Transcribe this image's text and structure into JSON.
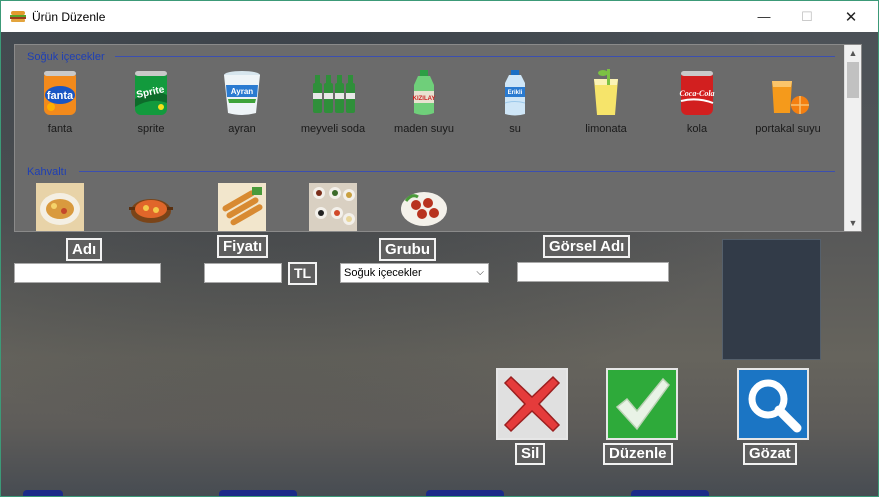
{
  "window": {
    "title": "Ürün Düzenle",
    "controls": {
      "minimize": "—",
      "maximize": "☐",
      "close": "✕"
    }
  },
  "groups": [
    {
      "name": "Soğuk içecekler",
      "items": [
        {
          "label": "fanta",
          "icon": "fanta-can-icon"
        },
        {
          "label": "sprite",
          "icon": "sprite-can-icon"
        },
        {
          "label": "ayran",
          "icon": "ayran-cup-icon"
        },
        {
          "label": "meyveli soda",
          "icon": "fruit-soda-bottles-icon"
        },
        {
          "label": "maden suyu",
          "icon": "mineral-water-bottle-icon"
        },
        {
          "label": "su",
          "icon": "water-bottle-icon"
        },
        {
          "label": "limonata",
          "icon": "lemonade-glass-icon"
        },
        {
          "label": "kola",
          "icon": "cola-can-icon"
        },
        {
          "label": "portakal suyu",
          "icon": "orange-juice-icon"
        }
      ]
    },
    {
      "name": "Kahvaltı",
      "items": [
        {
          "label": "",
          "icon": "breakfast-plate-icon"
        },
        {
          "label": "",
          "icon": "menemen-pan-icon"
        },
        {
          "label": "",
          "icon": "sigara-boregi-icon"
        },
        {
          "label": "",
          "icon": "breakfast-spread-icon"
        },
        {
          "label": "",
          "icon": "sucuk-plate-icon"
        }
      ]
    }
  ],
  "form": {
    "name_label": "Adı",
    "name_value": "",
    "price_label": "Fiyatı",
    "price_value": "",
    "currency": "TL",
    "group_label": "Grubu",
    "group_selected": "Soğuk içecekler",
    "image_label": "Görsel Adı",
    "image_value": ""
  },
  "actions": {
    "delete_label": "Sil",
    "edit_label": "Düzenle",
    "browse_label": "Gözat"
  },
  "colors": {
    "group_header": "#1e3fb5",
    "delete_bg": "#e0e0e0",
    "delete_x": "#e53b3b",
    "edit_bg": "#2eaa3a",
    "browse_bg": "#1b75c4"
  }
}
